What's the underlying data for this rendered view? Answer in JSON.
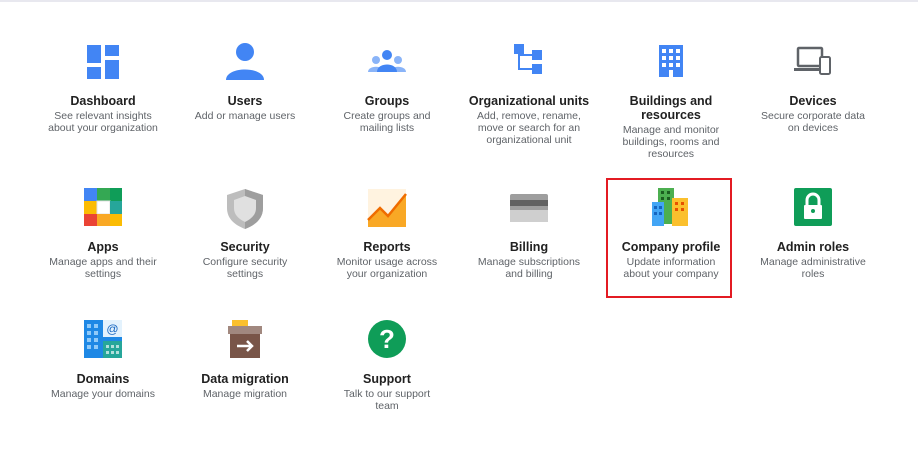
{
  "tiles": [
    {
      "id": "dashboard",
      "title": "Dashboard",
      "desc": "See relevant insights\nabout your organization",
      "icon": "dashboard-icon"
    },
    {
      "id": "users",
      "title": "Users",
      "desc": "Add or manage users",
      "icon": "user-icon"
    },
    {
      "id": "groups",
      "title": "Groups",
      "desc": "Create groups and\nmailing lists",
      "icon": "groups-icon"
    },
    {
      "id": "org-units",
      "title": "Organizational units",
      "desc": "Add, remove, rename,\nmove or search for an\norganizational unit",
      "icon": "org-units-icon"
    },
    {
      "id": "buildings",
      "title": "Buildings and\nresources",
      "desc": "Manage and monitor\nbuildings, rooms and\nresources",
      "icon": "building-icon"
    },
    {
      "id": "devices",
      "title": "Devices",
      "desc": "Secure corporate data\non devices",
      "icon": "devices-icon"
    },
    {
      "id": "apps",
      "title": "Apps",
      "desc": "Manage apps and their\nsettings",
      "icon": "apps-icon"
    },
    {
      "id": "security",
      "title": "Security",
      "desc": "Configure security\nsettings",
      "icon": "shield-icon"
    },
    {
      "id": "reports",
      "title": "Reports",
      "desc": "Monitor usage across\nyour organization",
      "icon": "reports-icon"
    },
    {
      "id": "billing",
      "title": "Billing",
      "desc": "Manage subscriptions\nand billing",
      "icon": "credit-card-icon"
    },
    {
      "id": "company-profile",
      "title": "Company profile",
      "desc": "Update information\nabout your company",
      "icon": "company-buildings-icon",
      "highlighted": true
    },
    {
      "id": "admin-roles",
      "title": "Admin roles",
      "desc": "Manage administrative\nroles",
      "icon": "lock-icon"
    },
    {
      "id": "domains",
      "title": "Domains",
      "desc": "Manage your domains",
      "icon": "domains-icon"
    },
    {
      "id": "data-migration",
      "title": "Data migration",
      "desc": "Manage migration",
      "icon": "archive-box-icon"
    },
    {
      "id": "support",
      "title": "Support",
      "desc": "Talk to our support\nteam",
      "icon": "help-icon"
    }
  ],
  "colors": {
    "blue": "#4285f4",
    "highlight": "#e31b23",
    "green": "#0f9d58",
    "yellow": "#fbbc04",
    "orange": "#f9a825"
  }
}
